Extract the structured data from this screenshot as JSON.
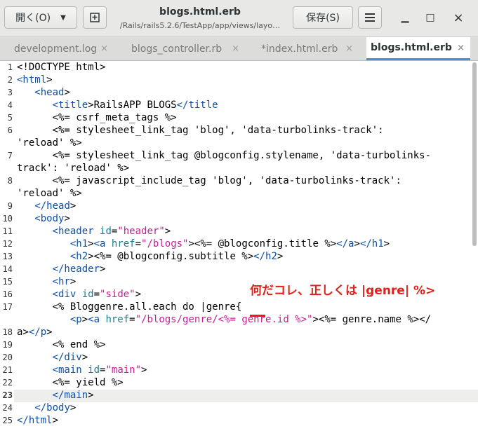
{
  "header": {
    "open_label": "開く(O)",
    "title": "blogs.html.erb",
    "path": "/Rails/rails5.2.6/TestApp/app/views/layo…",
    "save_label": "保存(S)"
  },
  "tabs": [
    {
      "label": "development.log"
    },
    {
      "label": "blogs_controller.rb"
    },
    {
      "label": "*index.html.erb"
    },
    {
      "label": "blogs.html.erb"
    }
  ],
  "code": {
    "current_line": 23,
    "line_numbers": [
      "1",
      "2",
      "3",
      "4",
      "5",
      "6",
      "7",
      "8",
      "9",
      "10",
      "11",
      "12",
      "13",
      "14",
      "15",
      "16",
      "17",
      "18",
      "19",
      "20",
      "21",
      "22",
      "23",
      "24",
      "25"
    ],
    "lines": [
      "<!DOCTYPE html>",
      "<html>",
      "   <head>",
      "      <title>RailsAPP BLOGS</title",
      "      <%= csrf_meta_tags %>",
      "      <%= stylesheet_link_tag 'blog', 'data-turbolinks-track':",
      "'reload' %>",
      "      <%= stylesheet_link_tag @blogconfig.stylename, 'data-turbolinks-",
      "track': 'reload' %>",
      "      <%= javascript_include_tag 'blog', 'data-turbolinks-track':",
      "'reload' %>",
      "   </head>",
      "   <body>",
      "      <header id=\"header\">",
      "         <h1><a href=\"/blogs\"><%= @blogconfig.title %></a></h1>",
      "         <h2><%= @blogconfig.subtitle %></h2>",
      "      </header>",
      "      <hr>",
      "      <div id=\"side\">",
      "      <% Bloggenre.all.each do |genre{",
      "         <p><a href=\"/blogs/genre/<%= genre.id %>\"><%= genre.name %></",
      "a></p>",
      "      <% end %>",
      "      </div>",
      "      <main id=\"main\">",
      "      <%= yield %>",
      "      </main>",
      "   </body>",
      "</html>"
    ]
  },
  "annotation": "何だコレ、正しくは |genre| %>",
  "colors": {
    "annotation": "#e0201a",
    "tag": "#0e4fa6",
    "string": "#c61c94",
    "attribute": "#1c7c8a"
  }
}
